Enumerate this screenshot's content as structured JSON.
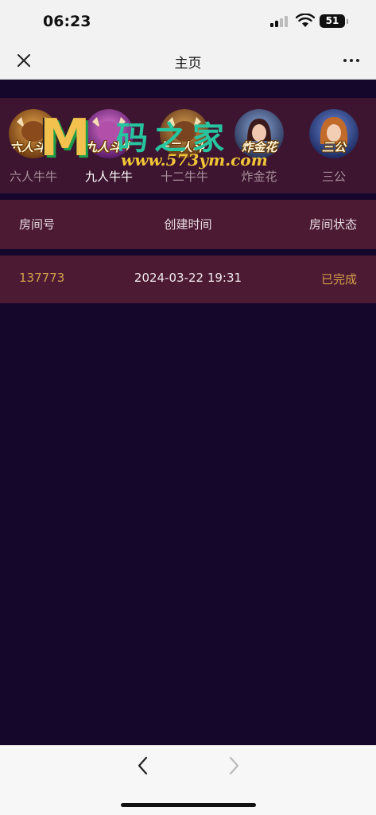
{
  "status_bar": {
    "time": "06:23",
    "battery": "51",
    "icons": [
      "signal-icon",
      "wifi-icon",
      "battery-icon"
    ]
  },
  "nav": {
    "title": "主页",
    "close_icon": "close-icon",
    "more_icon": "more-icon"
  },
  "games": [
    {
      "label": "六人牛牛",
      "icon_caption": "六人斗牛",
      "active": false
    },
    {
      "label": "九人牛牛",
      "icon_caption": "九人斗牛",
      "active": true
    },
    {
      "label": "十二牛牛",
      "icon_caption": "十二人斗牛",
      "active": false
    },
    {
      "label": "炸金花",
      "icon_caption": "炸金花",
      "active": false
    },
    {
      "label": "三公",
      "icon_caption": "三公",
      "active": false
    }
  ],
  "watermark": {
    "letter": "M",
    "name": "码之家",
    "url": "www.573ym.com"
  },
  "table": {
    "headers": [
      "房间号",
      "创建时间",
      "房间状态"
    ],
    "rows": [
      {
        "room_id": "137773",
        "created": "2024-03-22 19:31",
        "status": "已完成"
      }
    ]
  },
  "toolbar": {
    "back_icon": "chevron-left-icon",
    "forward_icon": "chevron-right-icon"
  },
  "colors": {
    "background": "#15062b",
    "panel": "#4c1a33",
    "accent_gold": "#d4a04a",
    "inactive_label": "#a98f9c"
  }
}
